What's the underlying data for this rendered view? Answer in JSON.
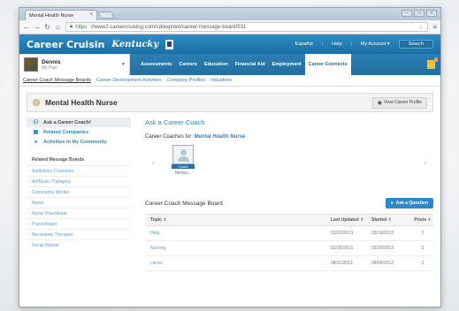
{
  "browser": {
    "tab_title": "Mental Health Nurse",
    "tab_close": "×",
    "url_scheme": "https",
    "url_rest": "://www2.careercruising.com/cd/explore/career-message-board/531"
  },
  "header": {
    "logo": "Career Cruisin",
    "state": "Kentucky",
    "links": [
      "Español",
      "Help",
      "My Account ▾"
    ],
    "search_label": "Search"
  },
  "user": {
    "name": "Dennis",
    "sub": "My Plan"
  },
  "main_nav": [
    "Assessments",
    "Careers",
    "Education",
    "Financial Aid",
    "Employment",
    "Career Connects"
  ],
  "main_nav_active": "Career Connects",
  "bookmark_count": "1",
  "sub_nav": {
    "active": "Career Coach Message Boards",
    "items": [
      "Career Development Activities",
      "Company Profiles",
      "Industries"
    ]
  },
  "page": {
    "title": "Mental Health Nurse",
    "view_profile": "View Career Profile"
  },
  "sidebar": {
    "items": [
      {
        "label": "Ask a Career Coach!",
        "icon": "chat-icon"
      },
      {
        "label": "Related Companies",
        "icon": "building-icon"
      },
      {
        "label": "Activities in My Community",
        "icon": "map-pin-icon"
      }
    ],
    "related_heading": "Related Message Boards",
    "related": [
      "Addictions Counselor",
      "Art/Music Therapist",
      "Community Worker",
      "Nurse",
      "Nurse Practitioner",
      "Psychologist",
      "Recreation Therapist",
      "Social Worker"
    ]
  },
  "main": {
    "ask_title": "Ask a Career Coach",
    "coaches_for_label": "Career Coaches for:",
    "coaches_for_value": "Mental Health Nurse",
    "coach": {
      "tag": "Coach",
      "name": "Melisa..."
    },
    "board_title": "Career Coach Message Board",
    "ask_button": "Ask a Question",
    "columns": [
      "Topic",
      "Last Updated",
      "Started",
      "Posts"
    ],
    "rows": [
      {
        "topic": "Help",
        "updated": "03/22/2013",
        "started": "03/19/2013",
        "posts": "2"
      },
      {
        "topic": "Nursing",
        "updated": "02/25/2013",
        "started": "02/20/2013",
        "posts": "2"
      },
      {
        "topic": "career",
        "updated": "08/11/2012",
        "started": "08/04/2012",
        "posts": "2"
      }
    ]
  }
}
